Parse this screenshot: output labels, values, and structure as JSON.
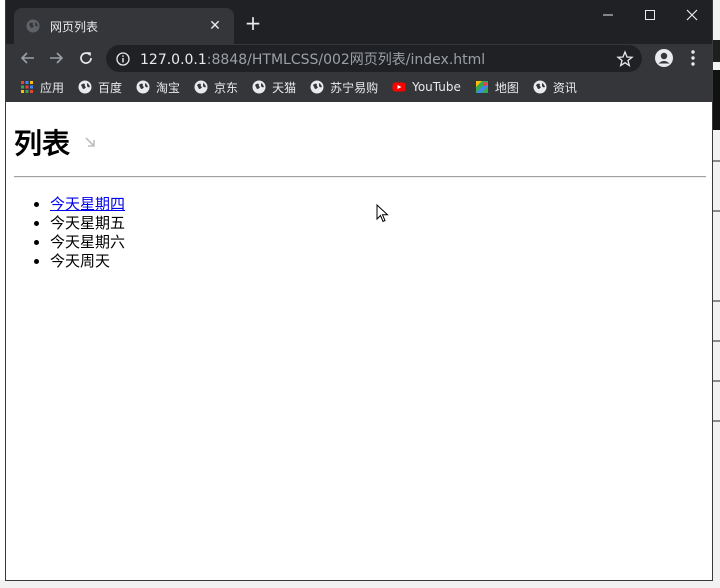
{
  "browser": {
    "tab_title": "网页列表",
    "tab_close": "✕",
    "new_tab": "+",
    "url_host": "127.0.0.1",
    "url_rest": ":8848/HTMLCSS/002网页列表/index.html",
    "bookmarks": [
      {
        "label": "应用",
        "icon": "apps-grid-icon"
      },
      {
        "label": "百度",
        "icon": "globe-icon"
      },
      {
        "label": "淘宝",
        "icon": "globe-icon"
      },
      {
        "label": "京东",
        "icon": "globe-icon"
      },
      {
        "label": "天猫",
        "icon": "globe-icon"
      },
      {
        "label": "苏宁易购",
        "icon": "globe-icon"
      },
      {
        "label": "YouTube",
        "icon": "youtube-icon"
      },
      {
        "label": "地图",
        "icon": "maps-icon"
      },
      {
        "label": "资讯",
        "icon": "globe-icon"
      }
    ]
  },
  "page": {
    "heading": "列表",
    "list_items": [
      {
        "text": "今天星期四",
        "link": true
      },
      {
        "text": "今天星期五",
        "link": false
      },
      {
        "text": "今天星期六",
        "link": false
      },
      {
        "text": "今天周天",
        "link": false
      }
    ]
  },
  "colors": {
    "titlebar": "#202124",
    "toolbar": "#35363a",
    "link": "#0000ee",
    "youtube_red": "#ff0000"
  }
}
